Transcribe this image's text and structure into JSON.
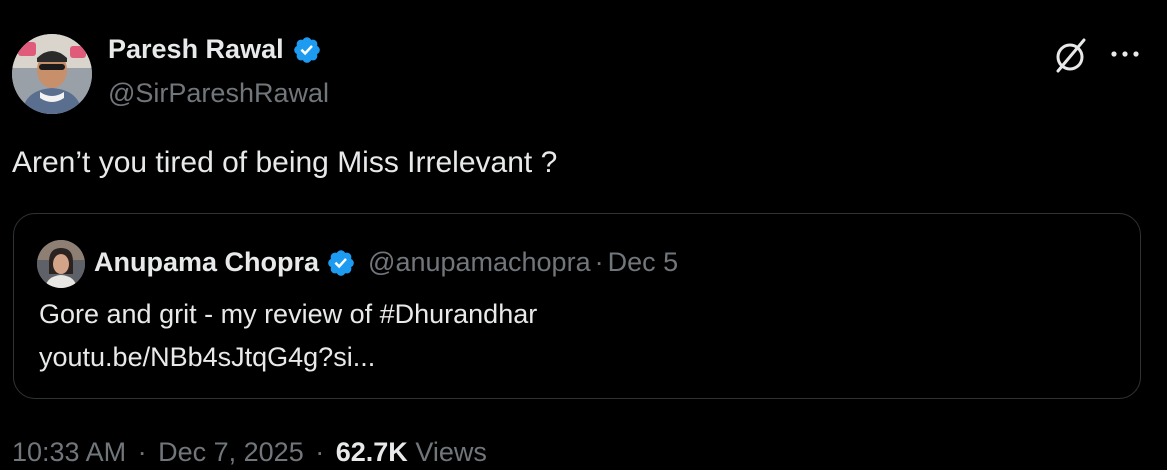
{
  "author": {
    "name": "Paresh Rawal",
    "handle": "@SirPareshRawal",
    "verified": true,
    "avatar_icon": "profile-photo"
  },
  "tweet": {
    "text": "Aren’t you tired of being Miss Irrelevant ?"
  },
  "quoted": {
    "name": "Anupama Chopra",
    "handle": "@anupamachopra",
    "separator": "·",
    "date": "Dec 5",
    "verified": true,
    "text_line1": "Gore and grit - my review of #Dhurandhar",
    "text_line2": "youtu.be/NBb4sJtqG4g?si..."
  },
  "meta": {
    "time": "10:33 AM",
    "separator": "·",
    "date": "Dec 7, 2025",
    "views_count": "62.7K",
    "views_label": "Views"
  },
  "actions": {
    "grok_icon": "grok-icon",
    "more_icon": "more-options-icon"
  },
  "colors": {
    "background": "#000000",
    "text_primary": "#e7e9ea",
    "text_secondary": "#71767b",
    "verified_blue": "#1d9bf0",
    "border": "#2f3336"
  }
}
